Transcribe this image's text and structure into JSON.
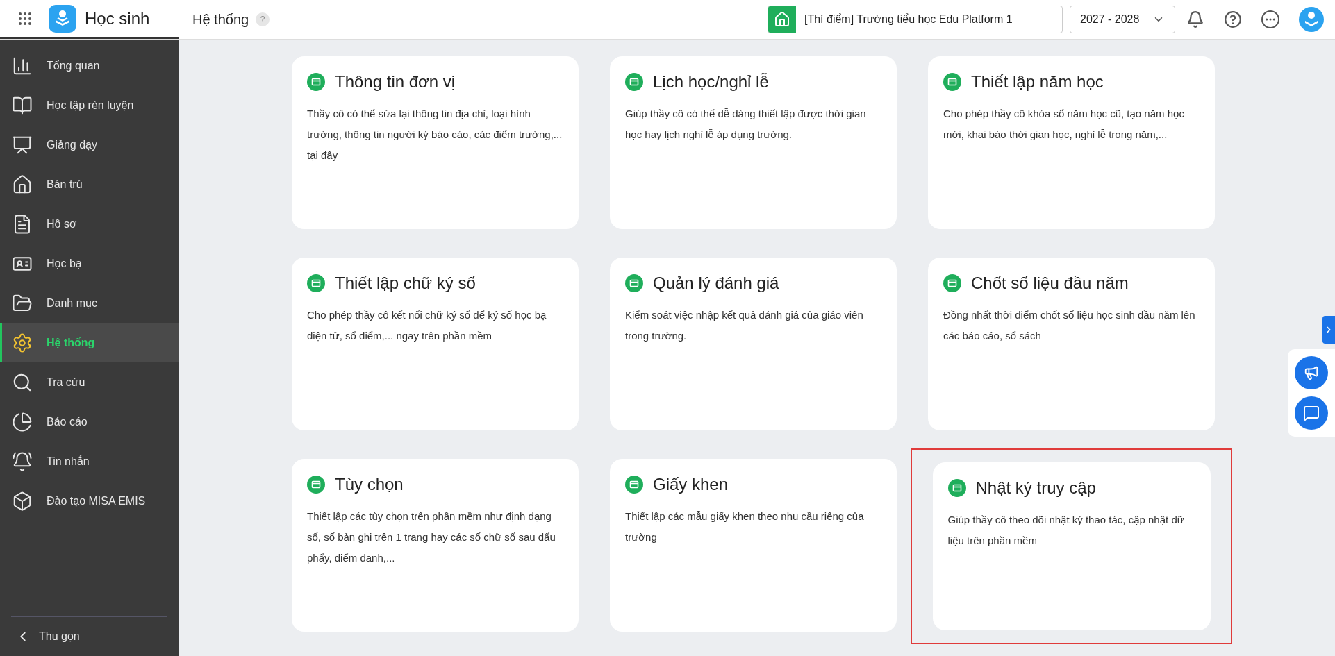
{
  "header": {
    "app_name": "Học sinh",
    "page_title": "Hệ thống",
    "help_badge": "?",
    "school": "[Thí điểm] Trường tiểu học Edu Platform 1",
    "school_year": "2027 - 2028"
  },
  "sidebar": {
    "items": [
      {
        "label": "Tổng quan",
        "kind": "chart",
        "selected": false
      },
      {
        "label": "Học tập rèn luyện",
        "kind": "book",
        "selected": false
      },
      {
        "label": "Giảng dạy",
        "kind": "board",
        "selected": false
      },
      {
        "label": "Bán trú",
        "kind": "house",
        "selected": false
      },
      {
        "label": "Hồ sơ",
        "kind": "file",
        "selected": false
      },
      {
        "label": "Học bạ",
        "kind": "record",
        "selected": false
      },
      {
        "label": "Danh mục",
        "kind": "folder",
        "selected": false
      },
      {
        "label": "Hệ thống",
        "kind": "gear",
        "selected": true
      },
      {
        "label": "Tra cứu",
        "kind": "search",
        "selected": false
      },
      {
        "label": "Báo cáo",
        "kind": "pie",
        "selected": false
      },
      {
        "label": "Tin nhắn",
        "kind": "bell",
        "selected": false
      },
      {
        "label": "Đào tạo MISA EMIS",
        "kind": "box",
        "selected": false
      }
    ],
    "collapse": "Thu gọn"
  },
  "cards": [
    {
      "title": "Thông tin đơn vị",
      "description": "Thầy cô có thể sửa lại thông tin địa chỉ, loại hình trường, thông tin người ký báo cáo, các điểm trường,... tại đây",
      "highlighted": false
    },
    {
      "title": "Lịch học/nghỉ lễ",
      "description": "Giúp thầy cô có thể dễ dàng thiết lập được thời gian học hay lịch nghỉ lễ áp dụng trường.",
      "highlighted": false
    },
    {
      "title": "Thiết lập năm học",
      "description": "Cho phép thầy cô khóa sổ năm học cũ, tạo năm học mới, khai báo thời gian học, nghỉ lễ trong năm,...",
      "highlighted": false
    },
    {
      "title": "Thiết lập chữ ký số",
      "description": "Cho phép thầy cô kết nối chữ ký số để ký số học bạ điện tử, sổ điểm,... ngay trên phần mềm",
      "highlighted": false
    },
    {
      "title": "Quản lý đánh giá",
      "description": "Kiểm soát việc nhập kết quả đánh giá của giáo viên trong trường.",
      "highlighted": false
    },
    {
      "title": "Chốt số liệu đầu năm",
      "description": "Đồng nhất thời điểm chốt số liệu học sinh đầu năm lên các báo cáo, sổ sách",
      "highlighted": false
    },
    {
      "title": "Tùy chọn",
      "description": "Thiết lập các tùy chọn trên phần mềm như định dạng số, số bản ghi trên 1 trang hay các số chữ số sau dấu phẩy, điểm danh,...",
      "highlighted": false
    },
    {
      "title": "Giấy khen",
      "description": "Thiết lập các mẫu giấy khen theo nhu cầu riêng của trường",
      "highlighted": false
    },
    {
      "title": "Nhật ký truy cập",
      "description": "Giúp thầy cô theo dõi nhật ký thao tác, cập nhật dữ liệu trên phần mềm",
      "highlighted": true
    }
  ]
}
